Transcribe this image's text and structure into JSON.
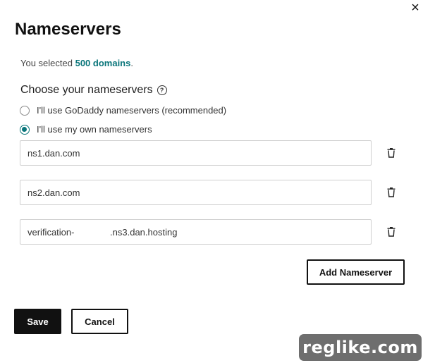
{
  "dialog": {
    "title": "Nameservers",
    "close_icon": "×"
  },
  "selection": {
    "prefix": "You selected ",
    "link": "500 domains",
    "suffix": "."
  },
  "choose": {
    "label": "Choose your nameservers",
    "help_icon": "?",
    "options": [
      {
        "label": "I'll use GoDaddy nameservers (recommended)",
        "checked": false
      },
      {
        "label": "I'll use my own nameservers",
        "checked": true
      }
    ]
  },
  "nameservers": [
    {
      "value": "ns1.dan.com"
    },
    {
      "value": "ns2.dan.com"
    },
    {
      "value": "verification-              .ns3.dan.hosting"
    }
  ],
  "buttons": {
    "add": "Add Nameserver",
    "save": "Save",
    "cancel": "Cancel"
  },
  "watermark": "reglike.com",
  "colors": {
    "accent": "#09757a",
    "primary_button": "#111111"
  }
}
